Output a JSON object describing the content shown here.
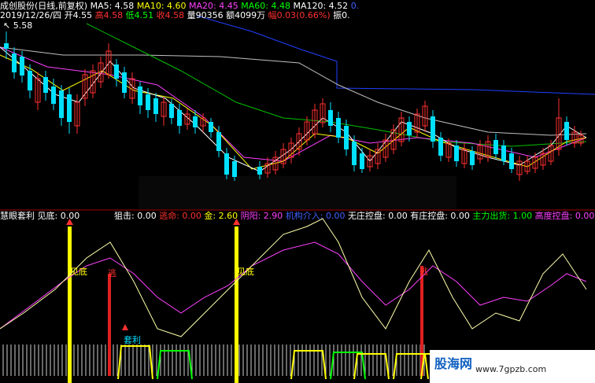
{
  "header": {
    "title": "成创股份(日线,前复权)",
    "ma5": "MA5: 4.58",
    "ma10": "MA10: 4.60",
    "ma20": "MA20: 4.45",
    "ma60": "MA60: 4.48",
    "ma120": "MA120: 4.52",
    "extra": "0.",
    "line2": {
      "date": "2019/12/26/四",
      "open": "开4.55",
      "high": "高4.58",
      "low": "低4.51",
      "close": "收4.58",
      "volume": "量90356",
      "amount": "额4099万",
      "change": "幅0.03(0.66%)",
      "amplitude": "振0."
    },
    "price_label": "5.58"
  },
  "indicator_header": {
    "name": "慧眼套利",
    "items": [
      {
        "label": "见底: 0.00",
        "color": "#ffffff"
      },
      {
        "label": "狙击: 0.00",
        "color": "#ffffff"
      },
      {
        "label": "逃命: 0.00",
        "color": "#ff3030"
      },
      {
        "label": "金: 2.60",
        "color": "#ffff00"
      },
      {
        "label": "阴阳: 2.90",
        "color": "#ff40ff"
      },
      {
        "label": "机构介入: 0.00",
        "color": "#4060ff"
      },
      {
        "label": "无庄控盘: 0.00",
        "color": "#ffffff"
      },
      {
        "label": "有庄控盘: 0.00",
        "color": "#ffffff"
      },
      {
        "label": "主力出货: 1.00",
        "color": "#00ff00"
      },
      {
        "label": "高度控盘: 0.00",
        "color": "#ff40ff"
      }
    ]
  },
  "signals": {
    "jiandi_1": "见底",
    "jiandi_2": "见底",
    "taoli": "套利",
    "taoming_1": "逃",
    "taoming_2": "逃"
  },
  "watermark": {
    "logo": "股海网",
    "url": "www.7gpzb.com"
  },
  "colors": {
    "up": "#ff3030",
    "down": "#00e0ff",
    "ma5": "#ffffff",
    "ma10": "#ffff00",
    "ma20": "#ff40ff",
    "ma60": "#00c000",
    "ma120": "#c0c0c0",
    "long": "#2040ff"
  }
}
